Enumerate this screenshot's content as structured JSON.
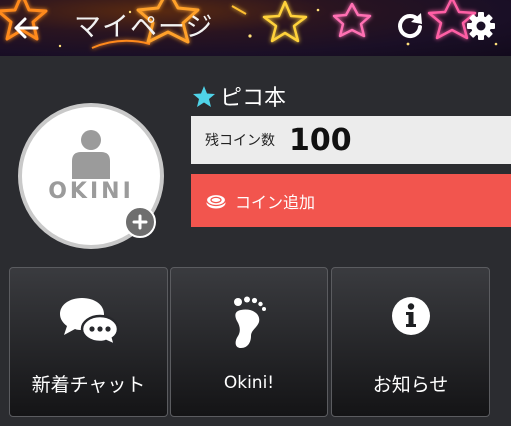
{
  "header": {
    "title": "マイページ",
    "accent": "#f5a623"
  },
  "profile": {
    "avatar_text": "OKINI",
    "name": "ピコ本",
    "coin_label": "残コイン数",
    "coin_value": "100",
    "add_coin_label": "コイン追加",
    "add_coin_color": "#f2554e"
  },
  "tiles": [
    {
      "label": "新着チャット",
      "icon": "chat-bubbles-icon"
    },
    {
      "label": "Okini!",
      "icon": "footprint-icon"
    },
    {
      "label": "お知らせ",
      "icon": "info-icon"
    }
  ]
}
